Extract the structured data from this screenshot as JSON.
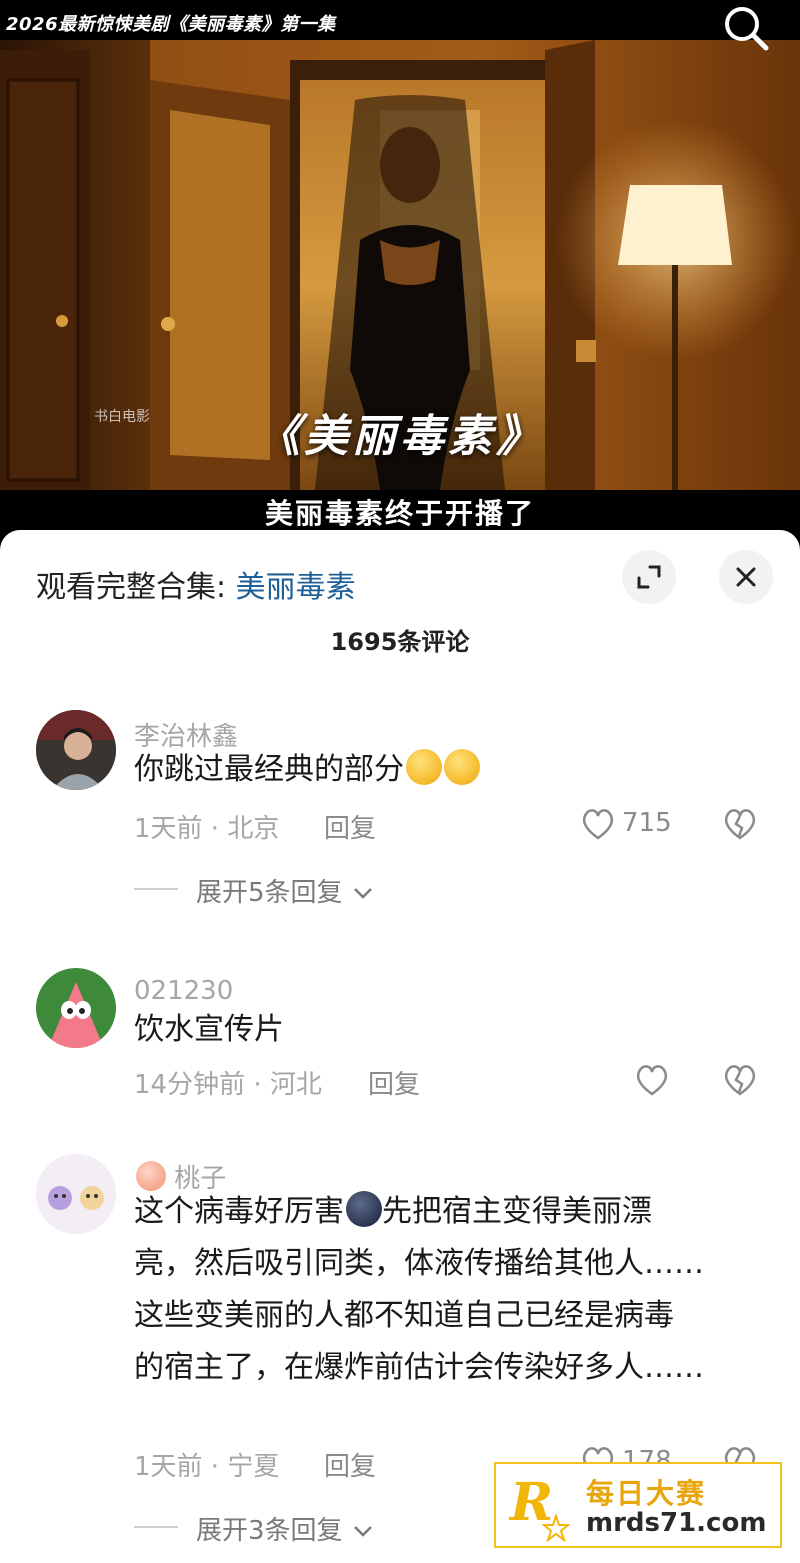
{
  "video": {
    "title": "2026最新惊悚美剧《美丽毒素》第一集",
    "show_title": "《美丽毒素》",
    "subtitle": "美丽毒素终于开播了",
    "watermark": "书白电影"
  },
  "sheet": {
    "header_prefix": "观看完整合集: ",
    "header_link": "美丽毒素",
    "comment_count": "1695条评论"
  },
  "comments": [
    {
      "user": "李治林鑫",
      "text": "你跳过最经典的部分",
      "time_location": "1天前 · 北京",
      "reply": "回复",
      "likes": "715",
      "expand": "展开5条回复"
    },
    {
      "user": "021230",
      "text": "饮水宣传片",
      "time_location": "14分钟前 · 河北",
      "reply": "回复",
      "likes": "",
      "expand": ""
    },
    {
      "user": "桃子",
      "text_line1": "这个病毒好厉害",
      "text_line1b": "先把宿主变得美丽漂",
      "text_line2": "亮，然后吸引同类，体液传播给其他人……",
      "text_line3": "这些变美丽的人都不知道自己已经是病毒",
      "text_line4": "的宿主了，在爆炸前估计会传染好多人……",
      "time_location": "1天前 · 宁夏",
      "reply": "回复",
      "likes": "178",
      "expand": "展开3条回复"
    }
  ],
  "site_badge": {
    "logo_letter": "R",
    "name": "每日大赛",
    "url": "mrds71.com"
  },
  "colors": {
    "link": "#1f5f98",
    "meta": "#a6a6a6",
    "badge_accent": "#f2b60a"
  }
}
